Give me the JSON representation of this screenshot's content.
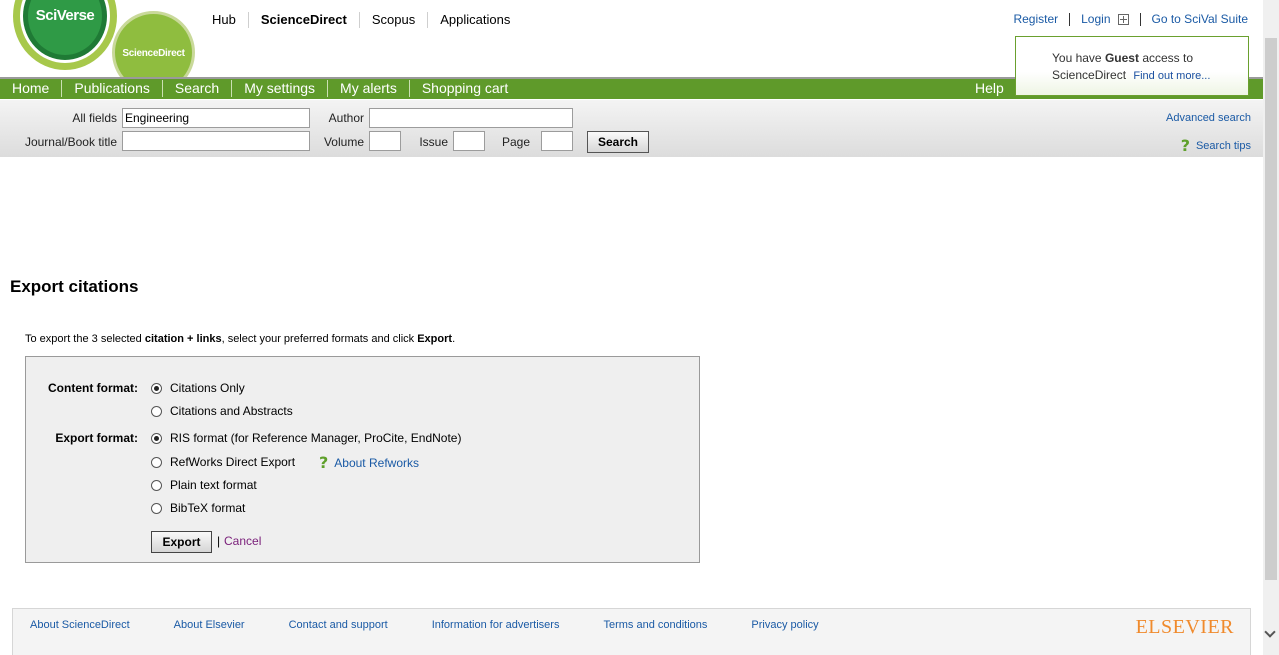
{
  "logos": {
    "sciverse": "SciVerse",
    "sciencedirect": "ScienceDirect"
  },
  "top_nav": {
    "items": [
      "Hub",
      "ScienceDirect",
      "Scopus",
      "Applications"
    ],
    "active": "ScienceDirect"
  },
  "top_right": {
    "register": "Register",
    "login": "Login",
    "scival": "Go to SciVal Suite"
  },
  "guest": {
    "prefix": "You have",
    "bold": "Guest",
    "suffix": "access to",
    "line2": "ScienceDirect",
    "link": "Find out more..."
  },
  "main_nav": {
    "items": [
      "Home",
      "Publications",
      "Search",
      "My settings",
      "My alerts",
      "Shopping cart"
    ],
    "help": "Help"
  },
  "search": {
    "all_fields_label": "All fields",
    "all_fields_value": "Engineering",
    "author_label": "Author",
    "author_value": "",
    "journal_label": "Journal/Book title",
    "journal_value": "",
    "volume_label": "Volume",
    "issue_label": "Issue",
    "page_label": "Page",
    "button": "Search",
    "advanced": "Advanced search",
    "tips": "Search tips"
  },
  "page": {
    "title": "Export citations",
    "intro_a": "To export the 3 selected",
    "intro_b": "citation + links",
    "intro_c": ", select your preferred formats and click",
    "intro_d": "Export",
    "intro_e": "."
  },
  "export": {
    "content_label": "Content format:",
    "content_options": [
      "Citations Only",
      "Citations and Abstracts"
    ],
    "content_selected": 0,
    "format_label": "Export format:",
    "format_options": [
      "RIS format (for Reference Manager, ProCite, EndNote)",
      "RefWorks Direct Export",
      "Plain text format",
      "BibTeX format"
    ],
    "format_selected": 0,
    "about_refworks": "About Refworks",
    "export_button": "Export",
    "separator": "|",
    "cancel": "Cancel"
  },
  "footer": {
    "links": [
      "About ScienceDirect",
      "About Elsevier",
      "Contact and support",
      "Information for advertisers",
      "Terms and conditions",
      "Privacy policy"
    ],
    "brand": "ELSEVIER"
  },
  "colors": {
    "green_bar": "#5f9a2a",
    "link": "#1a5aa5",
    "cancel_link": "#7a1f7a",
    "elsevier": "#f08a2c"
  }
}
